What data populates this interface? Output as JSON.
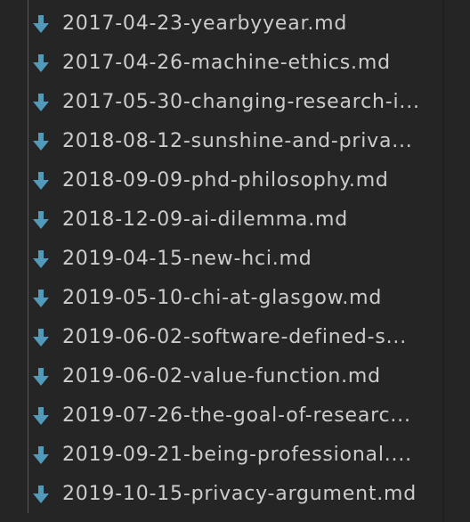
{
  "explorer": {
    "files": [
      {
        "name": "2017-04-23-yearbyyear.md",
        "icon": "markdown-download-icon"
      },
      {
        "name": "2017-04-26-machine-ethics.md",
        "icon": "markdown-download-icon"
      },
      {
        "name": "2017-05-30-changing-research-i...",
        "icon": "markdown-download-icon"
      },
      {
        "name": "2018-08-12-sunshine-and-priva...",
        "icon": "markdown-download-icon"
      },
      {
        "name": "2018-09-09-phd-philosophy.md",
        "icon": "markdown-download-icon"
      },
      {
        "name": "2018-12-09-ai-dilemma.md",
        "icon": "markdown-download-icon"
      },
      {
        "name": "2019-04-15-new-hci.md",
        "icon": "markdown-download-icon"
      },
      {
        "name": "2019-05-10-chi-at-glasgow.md",
        "icon": "markdown-download-icon"
      },
      {
        "name": "2019-06-02-software-defined-s...",
        "icon": "markdown-download-icon"
      },
      {
        "name": "2019-06-02-value-function.md",
        "icon": "markdown-download-icon"
      },
      {
        "name": "2019-07-26-the-goal-of-researc...",
        "icon": "markdown-download-icon"
      },
      {
        "name": "2019-09-21-being-professional....",
        "icon": "markdown-download-icon"
      },
      {
        "name": "2019-10-15-privacy-argument.md",
        "icon": "markdown-download-icon"
      }
    ]
  },
  "colors": {
    "background": "#252526",
    "text": "#cccccc",
    "icon": "#519aba",
    "indent_guide": "#585858"
  }
}
